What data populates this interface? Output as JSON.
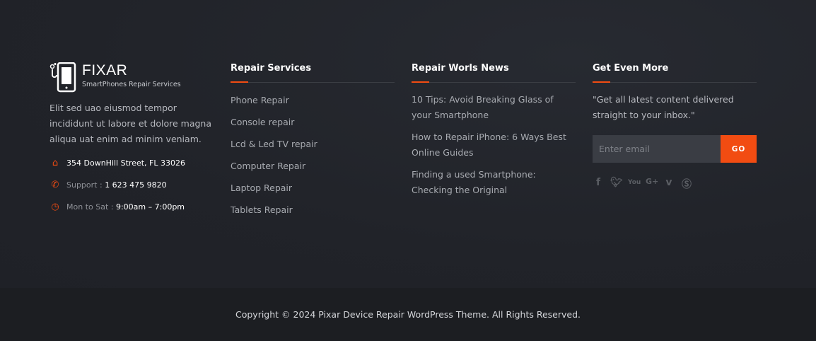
{
  "brand": {
    "name": "FIXAR",
    "tagline": "SmartPhones Repair Services"
  },
  "about": {
    "description": "Elit sed uao eiusmod tempor incididunt ut labore et dolore magna aliqua uat enim ad minim veniam.",
    "address": "354 DownHill Street, FL 33026",
    "support_label": "Support :",
    "support_value": "1 623 475 9820",
    "hours_label": "Mon to Sat :",
    "hours_value": "9:00am – 7:00pm"
  },
  "services": {
    "title": "Repair Services",
    "items": [
      "Phone Repair",
      "Console repair",
      "Lcd & Led TV repair",
      "Computer Repair",
      "Laptop Repair",
      "Tablets Repair"
    ]
  },
  "news": {
    "title": "Repair Worls News",
    "items": [
      "10 Tips: Avoid Breaking Glass of your Smartphone",
      "How to Repair iPhone: 6 Ways Best Online Guides",
      "Finding a used Smartphone: Checking the Original"
    ]
  },
  "newsletter": {
    "title": "Get Even More",
    "text": "\"Get all latest content delivered straight to your inbox.\"",
    "placeholder": "Enter email",
    "button": "GO",
    "social": [
      "facebook-icon",
      "twitter-icon",
      "youtube-icon",
      "google-plus-icon",
      "vimeo-icon",
      "skype-icon"
    ]
  },
  "copyright": "Copyright © 2024 Pixar Device Repair WordPress Theme. All Rights Reserved.",
  "colors": {
    "accent": "#f24c12",
    "background": "#212329",
    "bottom_bar": "#1c1e22"
  }
}
